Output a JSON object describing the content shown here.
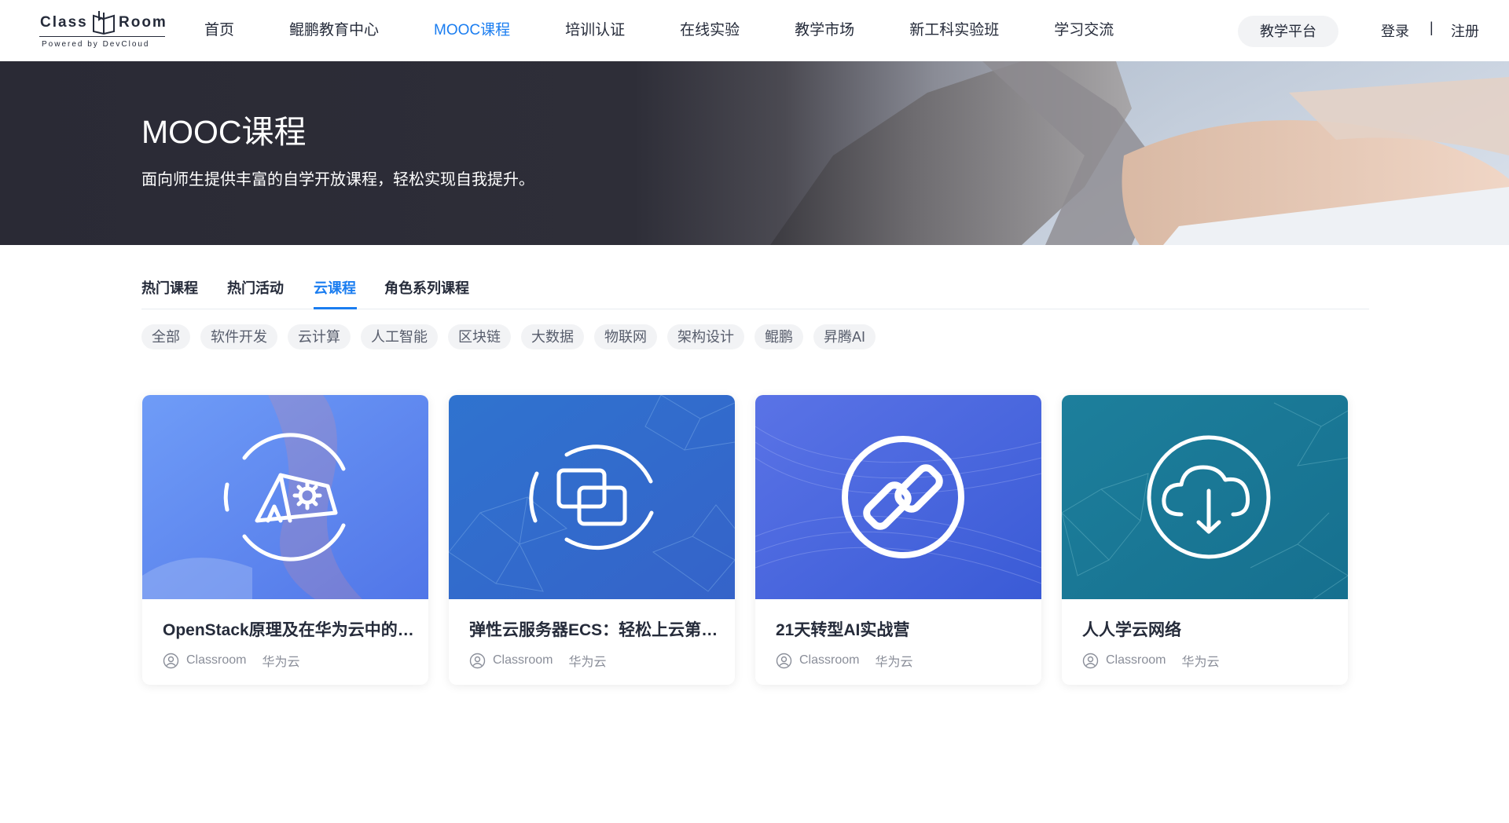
{
  "header": {
    "logo_left": "Class",
    "logo_right": "Room",
    "logo_sub": "Powered by DevCloud",
    "nav": [
      {
        "label": "首页",
        "active": false
      },
      {
        "label": "鲲鹏教育中心",
        "active": false
      },
      {
        "label": "MOOC课程",
        "active": true
      },
      {
        "label": "培训认证",
        "active": false
      },
      {
        "label": "在线实验",
        "active": false
      },
      {
        "label": "教学市场",
        "active": false
      },
      {
        "label": "新工科实验班",
        "active": false
      },
      {
        "label": "学习交流",
        "active": false
      }
    ],
    "platform_button": "教学平台",
    "login": "登录",
    "separator": "|",
    "register": "注册"
  },
  "banner": {
    "title": "MOOC课程",
    "subtitle": "面向师生提供丰富的自学开放课程，轻松实现自我提升。"
  },
  "tabs": [
    {
      "label": "热门课程",
      "active": false
    },
    {
      "label": "热门活动",
      "active": false
    },
    {
      "label": "云课程",
      "active": true
    },
    {
      "label": "角色系列课程",
      "active": false
    }
  ],
  "filters": [
    "全部",
    "软件开发",
    "云计算",
    "人工智能",
    "区块链",
    "大数据",
    "物联网",
    "架构设计",
    "鲲鹏",
    "昇腾AI"
  ],
  "courses": [
    {
      "title": "OpenStack原理及在华为云中的应用",
      "author": "Classroom",
      "provider": "华为云",
      "icon": "tent-gear-icon",
      "color": "#5b8ef2"
    },
    {
      "title": "弹性云服务器ECS：轻松上云第一步",
      "author": "Classroom",
      "provider": "华为云",
      "icon": "server-icon",
      "color": "#2f6fc6"
    },
    {
      "title": "21天转型AI实战营",
      "author": "Classroom",
      "provider": "华为云",
      "icon": "link-icon",
      "color": "#4a6ae0"
    },
    {
      "title": "人人学云网络",
      "author": "Classroom",
      "provider": "华为云",
      "icon": "cloud-download-icon",
      "color": "#1a7d98"
    }
  ],
  "colors": {
    "accent": "#1a7df0",
    "text": "#252b3a",
    "muted": "#8a8e99"
  }
}
